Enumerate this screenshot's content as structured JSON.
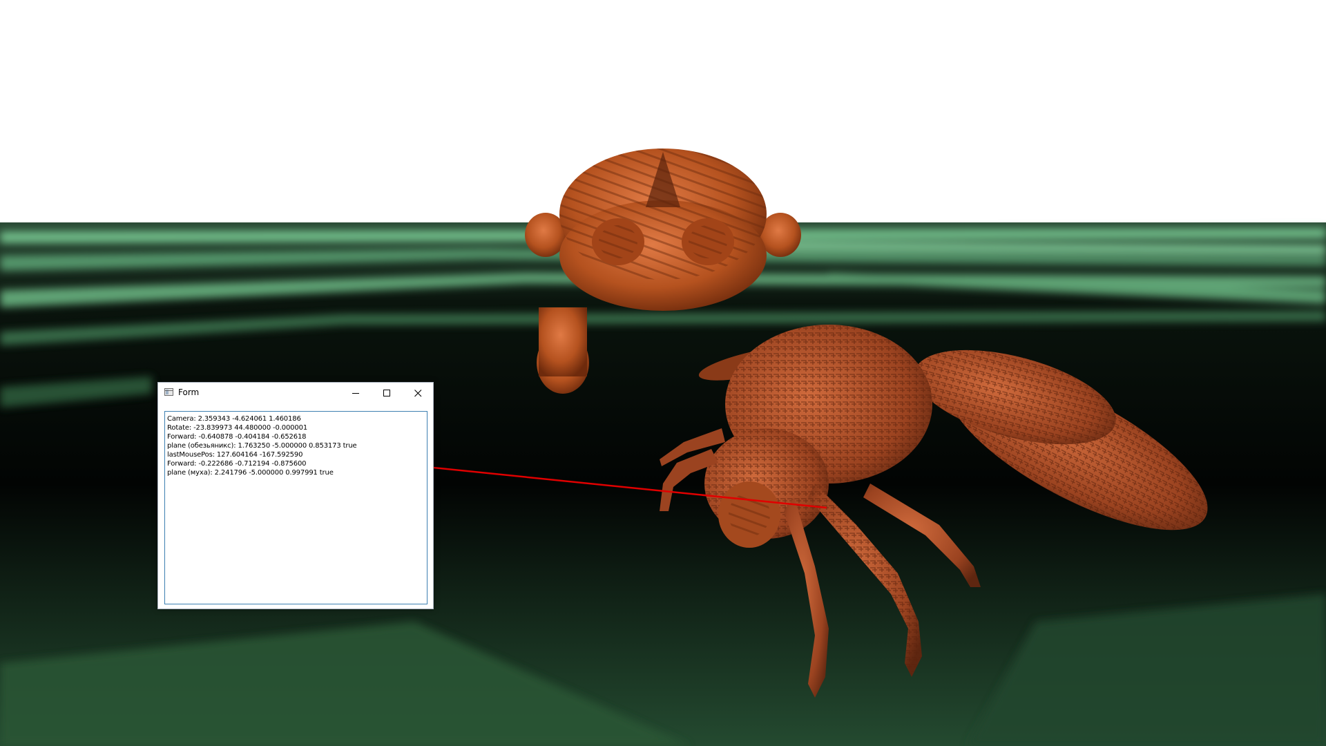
{
  "window": {
    "title": "Form"
  },
  "controls": {
    "minimize_icon": "minimize-icon",
    "maximize_icon": "maximize-icon",
    "close_icon": "close-icon"
  },
  "log": {
    "lines": [
      "Camera: 2.359343 -4.624061 1.460186",
      "Rotate: -23.839973 44.480000 -0.000001",
      "Forward: -0.640878 -0.404184 -0.652618",
      "plane (обезьяникс): 1.763250 -5.000000 0.853173 true",
      "lastMousePos: 127.604164 -167.592590",
      "Forward: -0.222686 -0.712194 -0.875600",
      "plane (муха): 2.241796 -5.000000 0.997991 true"
    ]
  },
  "scene": {
    "sky_color": "#ffffff",
    "floor_glow_color": "#7fd39a",
    "model_color": "#b8542a",
    "ray_color": "#e00000",
    "objects": [
      "monkey-head-model",
      "fly-model",
      "green-terrain-plane",
      "mouse-ray-line"
    ]
  }
}
